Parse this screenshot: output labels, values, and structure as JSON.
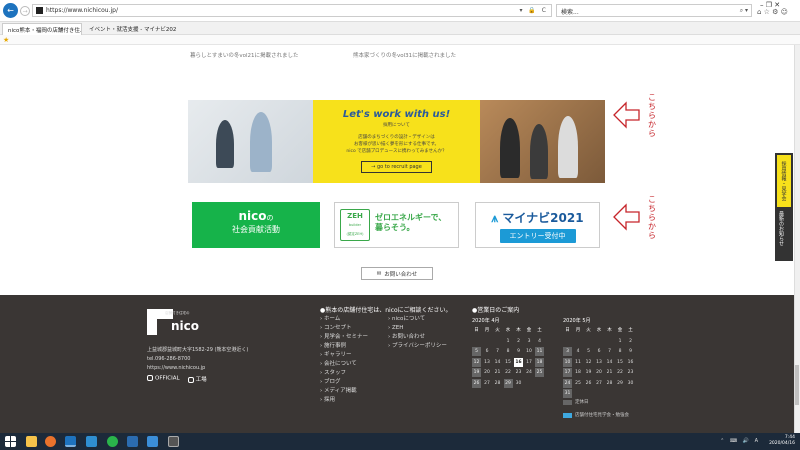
{
  "browser": {
    "url": "https://www.nichicou.jp/",
    "url_icons": "▾ 🔒 C",
    "search_placeholder": "検索...",
    "search_icon": "⌕ ▾",
    "toolbar_icons": "⌂ ☆ ⚙ ☺",
    "window_controls": "–  ❐  ✕",
    "tabs": [
      {
        "label": "nico熊本・福岡の店舗付き住...",
        "active": true
      },
      {
        "label": "イベント・就活支援 - マイナビ2021",
        "active": false
      }
    ]
  },
  "news": [
    "暮らしとすまいの冬vol21に掲載されました",
    "熊本家づくりの冬vol31に掲載されました"
  ],
  "recruit": {
    "title": "Let's work with us!",
    "subtitle": "採用について",
    "body_lines": [
      "店舗のまちづくりの設計・デザインは",
      "お客様が思い描く夢を形にする仕事です。",
      "nico で店舗プロデュースに携わってみませんか？"
    ],
    "button": "→ go to recruit page"
  },
  "arrow_label": "こちらから",
  "banners": {
    "nico_main": "nico",
    "nico_sub": "の",
    "nico_line2": "社会貢献活動",
    "zeh_logo": "ZEH",
    "zeh_logo_sub": "builder",
    "zeh_logo_small": "(認定ZEH)",
    "zeh_line1": "ゼロエネルギーで、",
    "zeh_line2": "暮らそう。",
    "mynavi_title": "マイナビ2021",
    "mynavi_button": "エントリー受付中"
  },
  "contact_button": "お問い合わせ",
  "side_tab": {
    "top": "採用情報・見学会",
    "bottom": "最新のお知らせ"
  },
  "footer": {
    "logo_text": "nico",
    "logo_small": "店舗付き住宅の",
    "address_lines": [
      "上益城郡益城町大字1582-29 (熊本空港近く)",
      "tel.096-286-8700",
      "https://www.nichicou.jp"
    ],
    "social": [
      "OFFICIAL",
      "工場"
    ],
    "consult_heading": "●熊本の店舗付住宅は、nicoにご相談ください。",
    "links_col1": [
      "ホーム",
      "コンセプト",
      "見学会・セミナー",
      "施行事例",
      "ギャラリー",
      "会社について",
      "スタッフ",
      "ブログ",
      "メディア掲載",
      "採用"
    ],
    "links_col2": [
      "nicoについて",
      "ZEH",
      "お問い合わせ",
      "プライバシーポリシー"
    ],
    "business_heading": "●営業日のご案内",
    "legend_closed": "定休日",
    "legend_event": "店舗付住宅見学会・勉強会"
  },
  "calendars": [
    {
      "title": "2020年 4月",
      "headers": [
        "日",
        "月",
        "火",
        "水",
        "木",
        "金",
        "土"
      ],
      "cells": [
        "",
        "",
        "",
        "1",
        "2",
        "3",
        "4",
        "5",
        "6",
        "7",
        "8",
        "9",
        "10",
        "11",
        "12",
        "13",
        "14",
        "15",
        "16",
        "17",
        "18",
        "19",
        "20",
        "21",
        "22",
        "23",
        "24",
        "25",
        "26",
        "27",
        "28",
        "29",
        "30",
        "",
        ""
      ],
      "closed": [
        "5",
        "11",
        "12",
        "18",
        "19",
        "25",
        "26",
        "29"
      ],
      "today": "16"
    },
    {
      "title": "2020年 5月",
      "headers": [
        "日",
        "月",
        "火",
        "水",
        "木",
        "金",
        "土"
      ],
      "cells": [
        "",
        "",
        "",
        "",
        "",
        "1",
        "2",
        "3",
        "4",
        "5",
        "6",
        "7",
        "8",
        "9",
        "10",
        "11",
        "12",
        "13",
        "14",
        "15",
        "16",
        "17",
        "18",
        "19",
        "20",
        "21",
        "22",
        "23",
        "24",
        "25",
        "26",
        "27",
        "28",
        "29",
        "30",
        "31",
        "",
        "",
        "",
        "",
        "",
        ""
      ],
      "closed": [
        "3",
        "10",
        "17",
        "24",
        "31"
      ],
      "today": ""
    }
  ],
  "taskbar": {
    "tray": "⌃ ⌨ 🔊 A",
    "time": "7:44",
    "date": "2020/04/16"
  },
  "colors": {
    "accent_yellow": "#f7e11b",
    "nico_green": "#16b34a",
    "zeh_green": "#3aa84a",
    "mynavi_blue": "#1c9ad6",
    "arrow_red": "#c6252b",
    "footer_bg": "#3a3634"
  }
}
